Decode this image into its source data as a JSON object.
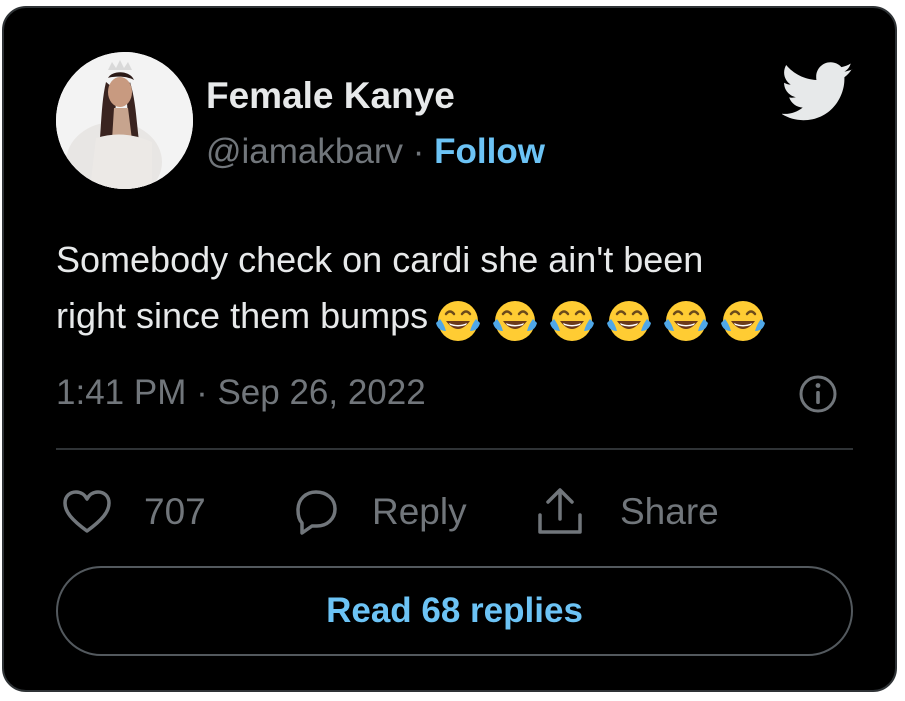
{
  "author": {
    "display_name": "Female Kanye",
    "handle": "@iamakbarv",
    "separator": "·",
    "follow_label": "Follow"
  },
  "tweet": {
    "text_line1": "Somebody check on cardi she ain't been",
    "text_line2": "right since them bumps",
    "emoji_name": "face-with-tears-of-joy",
    "emoji_count": 6,
    "timestamp": "1:41 PM · Sep 26, 2022"
  },
  "actions": {
    "like_count": "707",
    "reply_label": "Reply",
    "share_label": "Share"
  },
  "read_replies_label": "Read 68 replies",
  "colors": {
    "background": "#000000",
    "text": "#e7e9ea",
    "muted": "#71767b",
    "accent": "#6cc3f5",
    "border": "#2f3336"
  }
}
